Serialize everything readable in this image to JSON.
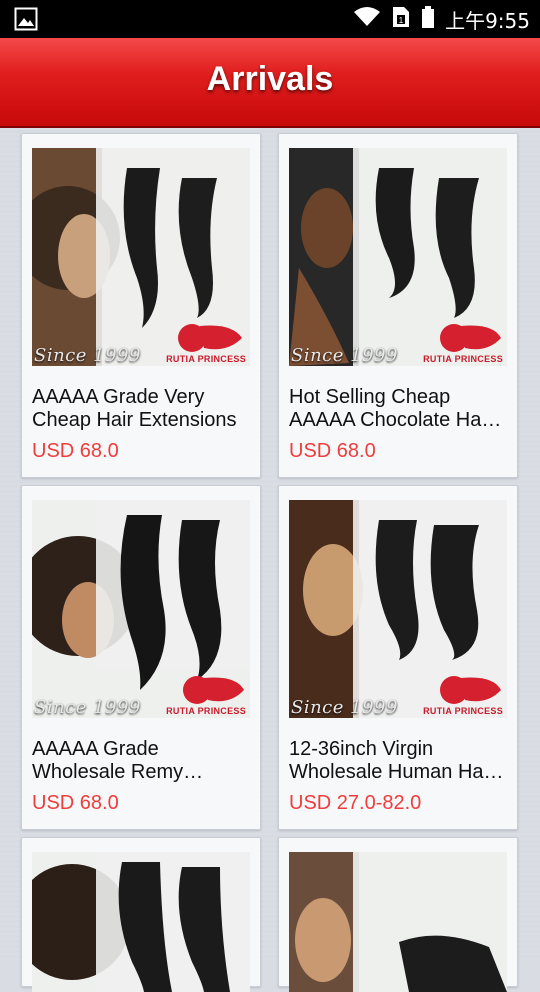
{
  "status_bar": {
    "time": "上午9:55",
    "icons": [
      "gallery-notification-icon",
      "wifi-icon",
      "sim-icon",
      "battery-icon"
    ]
  },
  "header": {
    "title": "Arrivals"
  },
  "products": [
    {
      "title": "AAAAA Grade Very Cheap Hair Extensions",
      "price": "USD 68.0",
      "image": {
        "since_text": "Since 1999",
        "brand_text": "RUTIA PRINCESS"
      }
    },
    {
      "title": "Hot Selling Cheap AAAAA Chocolate Ha…",
      "price": "USD 68.0",
      "image": {
        "since_text": "Since 1999",
        "brand_text": "RUTIA PRINCESS"
      }
    },
    {
      "title": "AAAAA Grade Wholesale Remy…",
      "price": "USD 68.0",
      "image": {
        "since_text": "Since 1999",
        "brand_text": "RUTIA PRINCESS"
      }
    },
    {
      "title": "12-36inch Virgin Wholesale Human Ha…",
      "price": "USD 27.0-82.0",
      "image": {
        "since_text": "Since 1999",
        "brand_text": "RUTIA PRINCESS"
      }
    },
    {
      "title": "",
      "price": "",
      "image": {
        "since_text": "",
        "brand_text": ""
      }
    },
    {
      "title": "",
      "price": "",
      "image": {
        "since_text": "",
        "brand_text": ""
      }
    }
  ],
  "colors": {
    "header_red": "#e01e1e",
    "price_red": "#ef3d3d",
    "background": "#d7dbe2"
  }
}
